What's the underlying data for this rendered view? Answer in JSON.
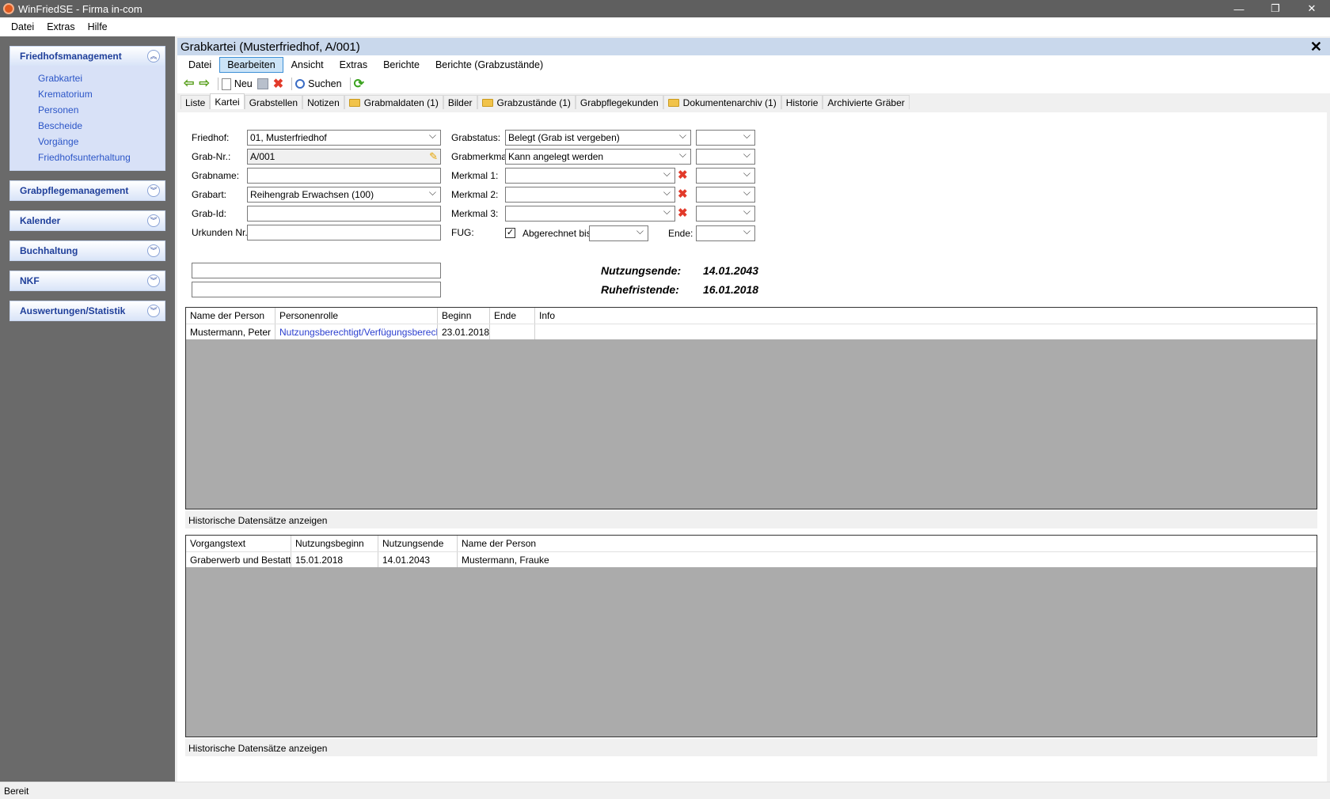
{
  "window": {
    "title": "WinFriedSE - Firma in-com",
    "minimize": "—",
    "restore": "❐",
    "close": "✕"
  },
  "menu": [
    "Datei",
    "Extras",
    "Hilfe"
  ],
  "nav": {
    "groups": [
      {
        "label": "Friedhofsmanagement",
        "expanded": true,
        "items": [
          "Grabkartei",
          "Krematorium",
          "Personen",
          "Bescheide",
          "Vorgänge",
          "Friedhofsunterhaltung"
        ]
      },
      {
        "label": "Grabpflegemanagement"
      },
      {
        "label": "Kalender"
      },
      {
        "label": "Buchhaltung"
      },
      {
        "label": "NKF"
      },
      {
        "label": "Auswertungen/Statistik"
      }
    ],
    "collapse_glyph": "︽",
    "expand_glyph": "︾"
  },
  "doc": {
    "title": "Grabkartei (Musterfriedhof, A/001)",
    "close": "✕",
    "menu": [
      "Datei",
      "Bearbeiten",
      "Ansicht",
      "Extras",
      "Berichte",
      "Berichte (Grabzustände)"
    ],
    "toolbar": {
      "new": "Neu",
      "search": "Suchen"
    },
    "tabs": [
      "Liste",
      "Kartei",
      "Grabstellen",
      "Notizen",
      "Grabmaldaten (1)",
      "Bilder",
      "Grabzustände (1)",
      "Grabpflegekunden",
      "Dokumentenarchiv (1)",
      "Historie",
      "Archivierte Gräber"
    ]
  },
  "form": {
    "friedhof_label": "Friedhof:",
    "friedhof": "01, Musterfriedhof",
    "grabnr_label": "Grab-Nr.:",
    "grabnr": "A/001",
    "grabname_label": "Grabname:",
    "grabname": "",
    "grabart_label": "Grabart:",
    "grabart": "Reihengrab Erwachsen (100)",
    "grabid_label": "Grab-Id:",
    "grabid": "",
    "urkunden_label": "Urkunden Nr.:",
    "urkunden": "",
    "grabstatus_label": "Grabstatus:",
    "grabstatus": "Belegt (Grab ist vergeben)",
    "grabmerkmal_label": "Grabmerkmal:",
    "grabmerkmal": "Kann angelegt werden",
    "merkmal1_label": "Merkmal 1:",
    "merkmal2_label": "Merkmal 2:",
    "merkmal3_label": "Merkmal 3:",
    "fug_label": "FUG:",
    "fug_checked": "✓",
    "abgerechnet_label": "Abgerechnet bis:",
    "ende_label": "Ende:",
    "nutzungsende_label": "Nutzungsende:",
    "nutzungsende": "14.01.2043",
    "ruhefristende_label": "Ruhefristende:",
    "ruhefristende": "16.01.2018"
  },
  "persons_table": {
    "headers": [
      "Name der Person",
      "Personenrolle",
      "Beginn",
      "Ende",
      "Info"
    ],
    "rows": [
      [
        "Mustermann, Peter",
        "Nutzungsberechtigt/Verfügungsberechtigt",
        "23.01.2018",
        "",
        ""
      ]
    ]
  },
  "history1": "Historische Datensätze anzeigen",
  "vorgang_table": {
    "headers": [
      "Vorgangstext",
      "Nutzungsbeginn",
      "Nutzungsende",
      "Name der Person"
    ],
    "rows": [
      [
        "Graberwerb und Bestattung",
        "15.01.2018",
        "14.01.2043",
        "Mustermann, Frauke"
      ]
    ]
  },
  "history2": "Historische Datensätze anzeigen",
  "status": "Bereit"
}
